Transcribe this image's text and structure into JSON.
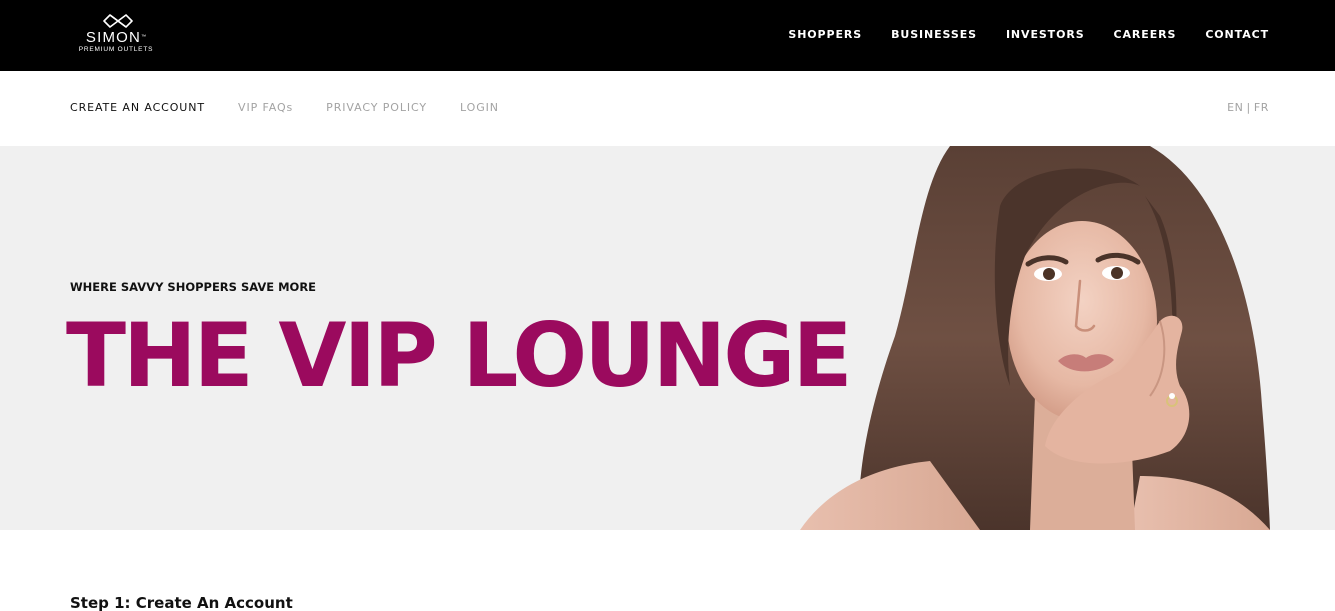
{
  "header": {
    "logo": {
      "brand": "SIMON",
      "tagline": "PREMIUM OUTLETS"
    },
    "nav": [
      {
        "label": "SHOPPERS"
      },
      {
        "label": "BUSINESSES"
      },
      {
        "label": "INVESTORS"
      },
      {
        "label": "CAREERS"
      },
      {
        "label": "CONTACT"
      }
    ]
  },
  "subnav": {
    "links": [
      {
        "label": "CREATE AN ACCOUNT",
        "active": true
      },
      {
        "label": "VIP FAQs",
        "active": false
      },
      {
        "label": "PRIVACY POLICY",
        "active": false
      },
      {
        "label": "LOGIN",
        "active": false
      }
    ],
    "language": {
      "en": "EN",
      "separator": "|",
      "fr": "FR"
    }
  },
  "hero": {
    "eyebrow": "WHERE SAVVY SHOPPERS SAVE MORE",
    "title": "THE VIP LOUNGE"
  },
  "content": {
    "step_title": "Step 1: Create An Account"
  },
  "colors": {
    "header_bg": "#000000",
    "hero_bg": "#f0f0f0",
    "accent": "#9b0a5e",
    "muted_link": "#a3a3a3"
  }
}
